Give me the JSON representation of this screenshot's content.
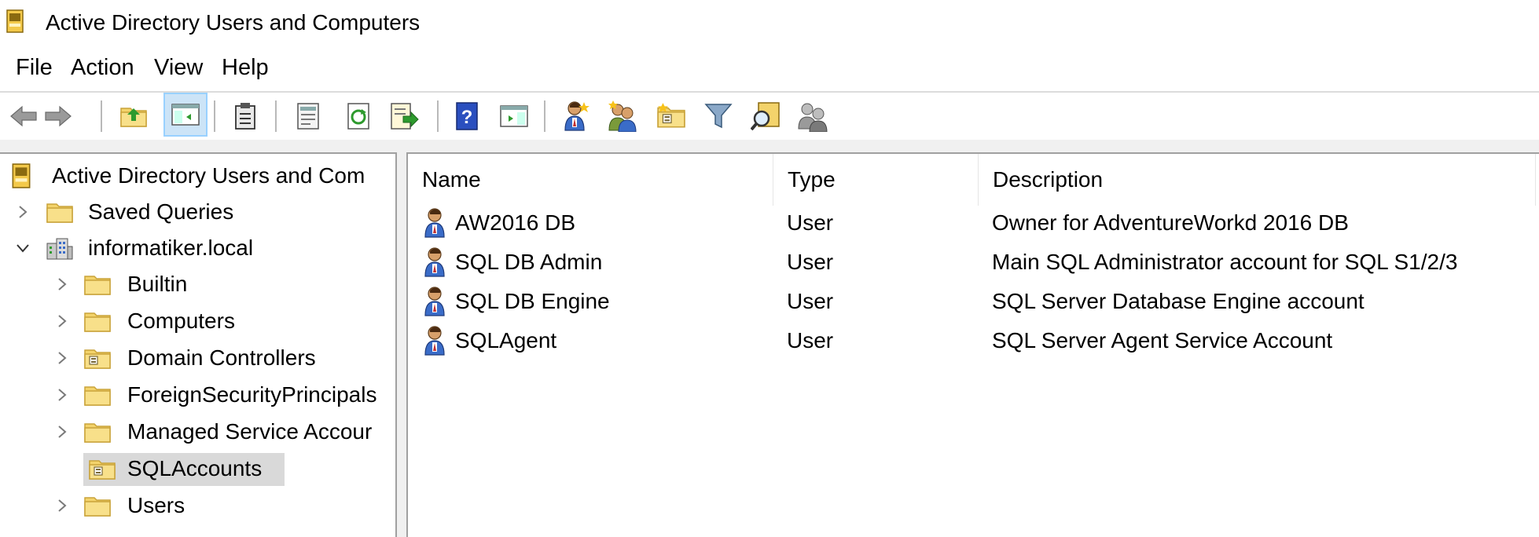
{
  "window": {
    "title": "Active Directory Users and Computers"
  },
  "menu": [
    "File",
    "Action",
    "View",
    "Help"
  ],
  "toolbar": {
    "buttons": [
      "back-arrow-icon",
      "forward-arrow-icon",
      "up-level-icon",
      "show-hide-tree-icon",
      "clipboard-icon",
      "properties-icon",
      "refresh-icon",
      "export-list-icon",
      "help-icon",
      "show-action-pane-icon",
      "new-user-icon",
      "new-group-icon",
      "new-ou-icon",
      "filter-icon",
      "find-icon",
      "delegate-control-icon"
    ]
  },
  "tree": {
    "root": "Active Directory Users and Com",
    "saved_queries": "Saved Queries",
    "domain": "informatiker.local",
    "children": [
      "Builtin",
      "Computers",
      "Domain Controllers",
      "ForeignSecurityPrincipals",
      "Managed Service Accour",
      "SQLAccounts",
      "Users"
    ],
    "selected": "SQLAccounts"
  },
  "list": {
    "columns": [
      "Name",
      "Type",
      "Description"
    ],
    "rows": [
      {
        "name": "AW2016 DB",
        "type": "User",
        "description": "Owner for AdventureWorkd 2016 DB"
      },
      {
        "name": "SQL DB Admin",
        "type": "User",
        "description": "Main SQL Administrator account for SQL S1/2/3"
      },
      {
        "name": "SQL DB Engine",
        "type": "User",
        "description": "SQL Server Database Engine account"
      },
      {
        "name": "SQLAgent",
        "type": "User",
        "description": "SQL Server Agent Service Account"
      }
    ]
  },
  "colors": {
    "selection": "#d9d9d9",
    "pressed": "#cce4f7",
    "folder": "#f3d36b",
    "help_blue": "#2a4fbf"
  }
}
